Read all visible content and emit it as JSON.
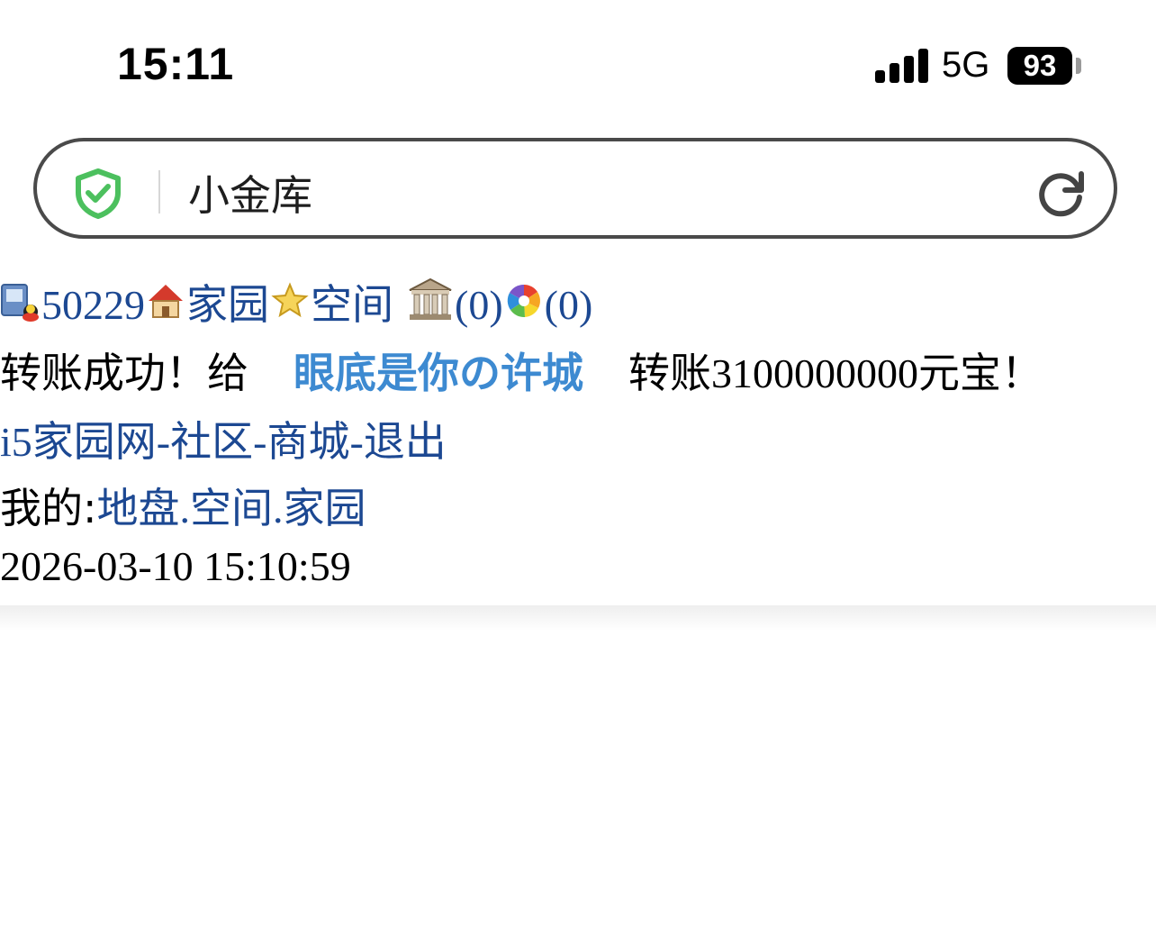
{
  "status_bar": {
    "time": "15:11",
    "network": "5G",
    "battery": "93"
  },
  "address_bar": {
    "title": "小金库"
  },
  "nav_row": {
    "user_id": "50229",
    "home_label": "家园",
    "space_label": "空间",
    "bank_count": "(0)",
    "album_count": "(0)"
  },
  "message": {
    "prefix": "转账成功！给",
    "recipient": "眼底是你の许城",
    "suffix": "转账3100000000元宝！"
  },
  "links": {
    "site": "i5家园网",
    "sep1": "-",
    "community": "社区",
    "sep2": "-",
    "mall": "商城",
    "sep3": "-",
    "logout": "退出"
  },
  "mine": {
    "label": "我的:",
    "land": "地盘",
    "dot1": ".",
    "space": "空间",
    "dot2": ".",
    "home": "家园"
  },
  "timestamp": "2026-03-10 15:10:59",
  "colors": {
    "link": "#1c4892",
    "recipient": "#3d8ad1",
    "shield": "#4cc05e"
  }
}
